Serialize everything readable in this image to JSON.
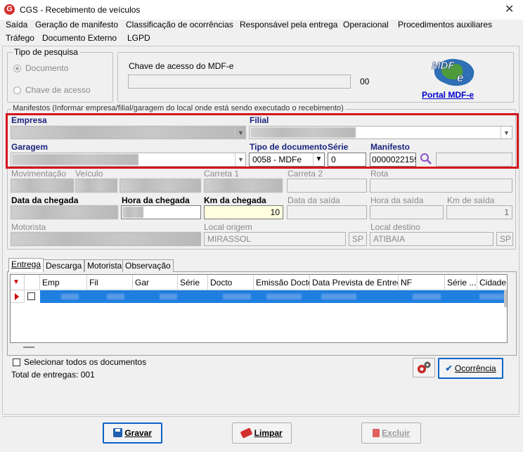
{
  "window": {
    "title": "CGS - Recebimento de veículos",
    "app_icon": "G"
  },
  "menu": [
    "Saída",
    "Geração de manifesto",
    "Classificação de ocorrências",
    "Responsável pela entrega",
    "Operacional",
    "Procedimentos auxiliares",
    "Tráfego",
    "Documento Externo",
    "LGPD"
  ],
  "tipo_pesquisa": {
    "legend": "Tipo de pesquisa",
    "opt_documento": "Documento",
    "opt_chave": "Chave de acesso"
  },
  "chave": {
    "label": "Chave de acesso do MDF-e",
    "count": "00",
    "portal_link": "Portal MDF-e",
    "logo_text": "MDF e"
  },
  "manifestos": {
    "legend": "Manifestos (Informar empresa/filial/garagem do local onde está sendo executado o recebimento)",
    "empresa_label": "Empresa",
    "filial_label": "Filial",
    "garagem_label": "Garagem",
    "tipo_doc_label": "Tipo de documento",
    "serie_label": "Série",
    "manifesto_label": "Manifesto",
    "tipo_doc_value": "0058 - MDFe",
    "serie_value": "0",
    "manifesto_value": "0000022159"
  },
  "info": {
    "movimentacao": "Movimentação",
    "veiculo": "Veículo",
    "carreta1": "Carreta 1",
    "carreta2": "Carreta 2",
    "rota": "Rota",
    "data_chegada": "Data da chegada",
    "hora_chegada": "Hora da chegada",
    "km_chegada": "Km da chegada",
    "km_chegada_value": "10",
    "data_saida": "Data da saída",
    "hora_saida": "Hora da saída",
    "km_saida": "Km de saída",
    "km_saida_value": "1",
    "motorista": "Motorista",
    "local_origem": "Local origem",
    "origem_value": "MIRASSOL",
    "origem_uf": "SP",
    "local_destino": "Local destino",
    "destino_value": "ATIBAIA",
    "destino_uf": "SP"
  },
  "tabs": [
    "Entrega",
    "Descarga",
    "Motorista",
    "Observação"
  ],
  "grid": {
    "columns": [
      "Emp",
      "Fil",
      "Gar",
      "Série",
      "Docto",
      "Emissão Docto",
      "Data Prevista de Entrega",
      "NF",
      "Série ...",
      "Cidade"
    ]
  },
  "footer": {
    "select_all": "Selecionar todos os documentos",
    "total": "Total de entregas: 001",
    "ocorrencia": "Ocorrência",
    "gravar": "Gravar",
    "limpar": "Limpar",
    "excluir": "Excluir"
  },
  "colors": {
    "highlight": "#d4151c",
    "selection": "#1e7fe0",
    "link": "#0000cc"
  }
}
